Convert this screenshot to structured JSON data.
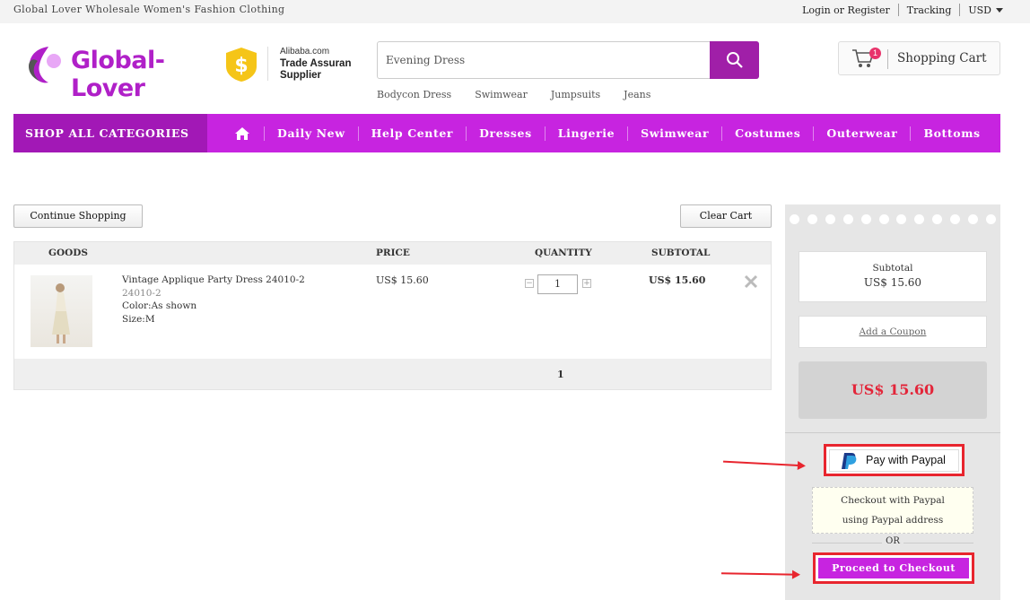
{
  "topbar": {
    "tagline": "Global Lover Wholesale Women's Fashion Clothing",
    "login": "Login or Register",
    "tracking": "Tracking",
    "currency": "USD"
  },
  "header": {
    "logo_text": "Global-Lover",
    "badge_line1": "Alibaba.com",
    "badge_line2": "Trade Assuran Supplier",
    "search_value": "Evening Dress",
    "search_links": [
      "Bodycon Dress",
      "Swimwear",
      "Jumpsuits",
      "Jeans"
    ],
    "cart_count": "1",
    "cart_label": "Shopping Cart"
  },
  "nav": {
    "shop_all": "SHOP ALL CATEGORIES",
    "items": [
      "Daily New",
      "Help Center",
      "Dresses",
      "Lingerie",
      "Swimwear",
      "Costumes",
      "Outerwear",
      "Bottoms"
    ]
  },
  "cart": {
    "continue_label": "Continue Shopping",
    "clear_label": "Clear Cart",
    "columns": {
      "goods": "GOODS",
      "price": "PRICE",
      "quantity": "QUANTITY",
      "subtotal": "SUBTOTAL"
    },
    "item": {
      "name": "Vintage Applique Party Dress 24010-2",
      "sku": "24010-2",
      "color": "Color:As shown",
      "size": "Size:M",
      "price": "US$ 15.60",
      "quantity": "1",
      "subtotal": "US$ 15.60"
    },
    "page": "1"
  },
  "summary": {
    "subtotal_label": "Subtotal",
    "subtotal_value": "US$ 15.60",
    "coupon_label": "Add a Coupon",
    "total": "US$ 15.60",
    "paypal_label": "Pay with Paypal",
    "note_line1": "Checkout with Paypal",
    "note_line2": "using Paypal address",
    "or_label": "OR",
    "checkout_label": "Proceed to Checkout"
  },
  "colors": {
    "brand_purple": "#c724e0",
    "dark_purple": "#a218b6",
    "price_red": "#e3263a",
    "highlight_red": "#e8252e"
  }
}
